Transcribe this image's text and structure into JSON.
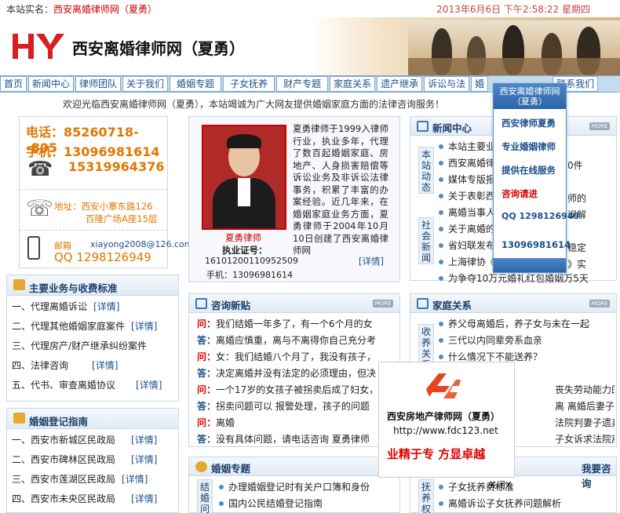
{
  "topbar": {
    "prefix": "本站实名：",
    "name": "西安离婚律师网（夏勇）",
    "datetime": "2013年6月6日 下午2:58:22 星期四"
  },
  "header": {
    "site_name": "西安离婚律师网（夏勇）",
    "logo_text": "HY"
  },
  "nav": [
    "首页",
    "新闻中心",
    "律师团队",
    "关于我们",
    "婚姻专题",
    "子女抚养",
    "财产专题",
    "家庭关系",
    "遗产继承",
    "诉讼与法",
    "婚",
    "联系我们"
  ],
  "welcome": "欢迎光临西安离婚律师网（夏勇），本站竭诚为广大网友提供婚姻家庭方面的法律咨询服务！",
  "contact": {
    "phone_label": "电话：",
    "phone": "85260718--805",
    "mobile_label": "手机：",
    "mobile": "13096981614",
    "mobile2": "15319964376",
    "address_label": "地址：",
    "address1": "西安小寨东路126",
    "address2": "百隆广场A座15层",
    "mail_label": "邮箱",
    "mail": "xiayong2008@126.com",
    "qq_label": "QQ",
    "qq": "1298126949"
  },
  "lawyer": {
    "bio": "夏勇律师于1999入律师行业，执业多年，代理了数百起婚姻家庭、房地产、人身损害赔偿等诉讼业务及非诉讼法律事务，积累了丰富的办案经验。近几年来，在婚姻家庭业务方面，夏勇律师于2004年10月10日创建了西安离婚律师网",
    "more": "[详情]",
    "name": "夏勇律师",
    "license_label": "执业证号：",
    "license": "16101200110952509",
    "mobile_label": "手机：",
    "mobile": "13096981614"
  },
  "business": {
    "title": "主要业务与收费标准",
    "items": [
      {
        "text": "一、代理离婚诉讼",
        "more": "[详情]"
      },
      {
        "text": "二、代理其他婚姻家庭案件",
        "more": "[详情]"
      },
      {
        "text": "三、代理房产/财产继承纠纷案件",
        "more": ""
      },
      {
        "text": "四、法律咨询",
        "more": "[详情]"
      },
      {
        "text": "五、代书、审查离婚协议",
        "more": "[详情]"
      }
    ]
  },
  "registry": {
    "title": "婚姻登记指南",
    "items": [
      {
        "text": "一、西安市新城区民政局",
        "more": "[详情]"
      },
      {
        "text": "二、西安市碑林区民政局",
        "more": "[详情]"
      },
      {
        "text": "三、西安市莲湖区民政局",
        "more": "[详情]"
      },
      {
        "text": "四、西安市未央区民政局",
        "more": "[详情]"
      }
    ]
  },
  "news": {
    "title": "新闻中心",
    "more": "MORE",
    "tab1": "本站动态",
    "tab2": "社会新闻",
    "items": [
      "本站主要业务与收费标准",
      "西安离婚律师网对离婚案件",
      "媒体专版报道律师夏勇",
      "关于表彰西安离婚律师的",
      "离婚当事人如何避免陷入误解",
      "关于离婚的法律问题解答",
      "省妇联发布家庭建设与稳定",
      "上海律协《婚姻家庭法律》",
      "为争夺10万元婚礼红包婚姻万5天"
    ]
  },
  "consult": {
    "title": "咨询新贴",
    "more": "MORE",
    "q_label": "问：",
    "a_label": "答：",
    "items": [
      {
        "t": "q",
        "text": "我们结婚一年多了，有一个6个月的女"
      },
      {
        "t": "a",
        "text": "离婚应慎重，离与不离得你自己充分考"
      },
      {
        "t": "q",
        "text": "女：我们结婚八个月了，我没有孩子，"
      },
      {
        "t": "a",
        "text": "决定离婚并没有法定的必须理由，但决"
      },
      {
        "t": "q",
        "text": "一个17岁的女孩子被拐卖后成了妇女，"
      },
      {
        "t": "a",
        "text": "拐卖问题可以 报警处理，孩子的问题"
      },
      {
        "t": "q",
        "text": "离婚"
      },
      {
        "t": "a",
        "text": "没有具体问题，请电话咨询 夏勇律师"
      }
    ]
  },
  "family": {
    "title": "家庭关系",
    "more": "MORE",
    "tab": "收养关系",
    "items": [
      "养父母离婚后，养子女与未在一起",
      "三代以内同辈旁系血亲",
      "什么情况下不能送养？",
      "",
      "丧失劳动能力的过",
      "离 离婚后妻子退",
      "法院判妻子遗弃罪",
      "子女诉求法院离婚"
    ]
  },
  "marriage": {
    "title": "婚姻专题",
    "tab": "结婚问题",
    "items": [
      "办理婚姻登记时有关户口簿和身份",
      "国内公民结婚登记指南"
    ]
  },
  "right_bottom": {
    "title": "我要咨询",
    "tab": "抚养权",
    "items": [
      "子女抚养费标准",
      "离婚诉讼子女抚养问题解析"
    ]
  },
  "float": {
    "title": "西安离婚律师网（夏勇）",
    "items": [
      "西安律师夏勇",
      "专业婚姻律师",
      "提供在线服务",
      "咨询请进",
      "QQ 1298126949",
      "13096981614"
    ]
  },
  "ad": {
    "name": "西安房地产律师网（夏勇）",
    "url": "http://www.fdc123.net",
    "slogan": "业精于专 方显卓越",
    "close": "关闭X"
  },
  "colors": {
    "accent": "#1a4f8a",
    "red": "#cc0000",
    "orange": "#e07800"
  }
}
